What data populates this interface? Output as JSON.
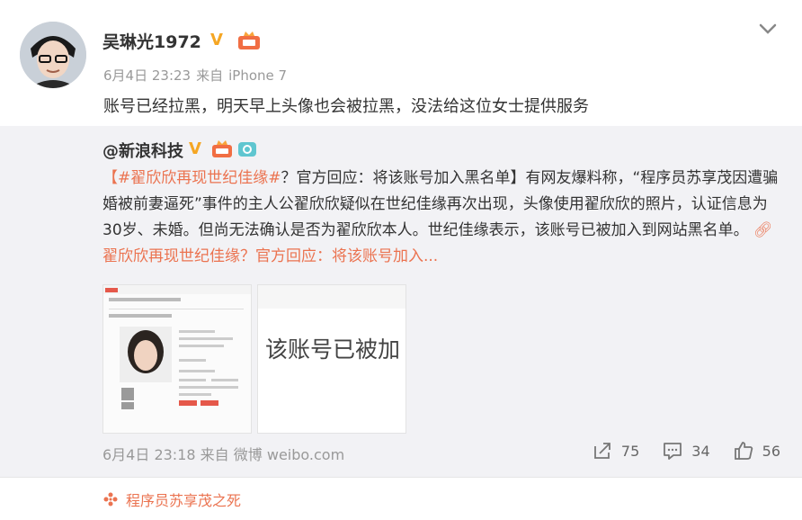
{
  "post": {
    "username": "吴琳光1972",
    "date": "6月4日 23:23",
    "source_prefix": "来自",
    "source": "iPhone 7",
    "text": "账号已经拉黑，明天早上头像也会被拉黑，没法给这位女士提供服务"
  },
  "repost": {
    "author": "@新浪科技",
    "body_hashtag": "【#翟欣欣再现世纪佳缘#",
    "body_text": "？官方回应：将该账号加入黑名单】有网友爆料称，“程序员苏享茂因遭骗婚被前妻逼死”事件的主人公翟欣欣疑似在世纪佳缘再次出现，头像使用翟欣欣的照片，认证信息为30岁、未婚。但尚无法确认是否为翟欣欣本人。世纪佳缘表示，该账号已被加入到网站黑名单。",
    "link_text": "翟欣欣再现世纪佳缘？官方回应：将该账号加入...",
    "image2_text": "该账号已被加",
    "date": "6月4日 23:18",
    "source_prefix": "来自",
    "source": "微博 weibo.com",
    "reposts": "75",
    "comments": "34",
    "likes": "56"
  },
  "topic": {
    "label": "程序员苏享茂之死"
  },
  "colors": {
    "accent": "#eb7350",
    "verified": "#f5a623",
    "muted": "#999999",
    "repost_bg": "#f2f2f5"
  },
  "icons": [
    "verified-v-icon",
    "level-badge-icon",
    "chevron-down-icon",
    "camera-badge-icon",
    "link-icon",
    "repost-icon",
    "comment-icon",
    "like-icon",
    "topic-icon"
  ]
}
